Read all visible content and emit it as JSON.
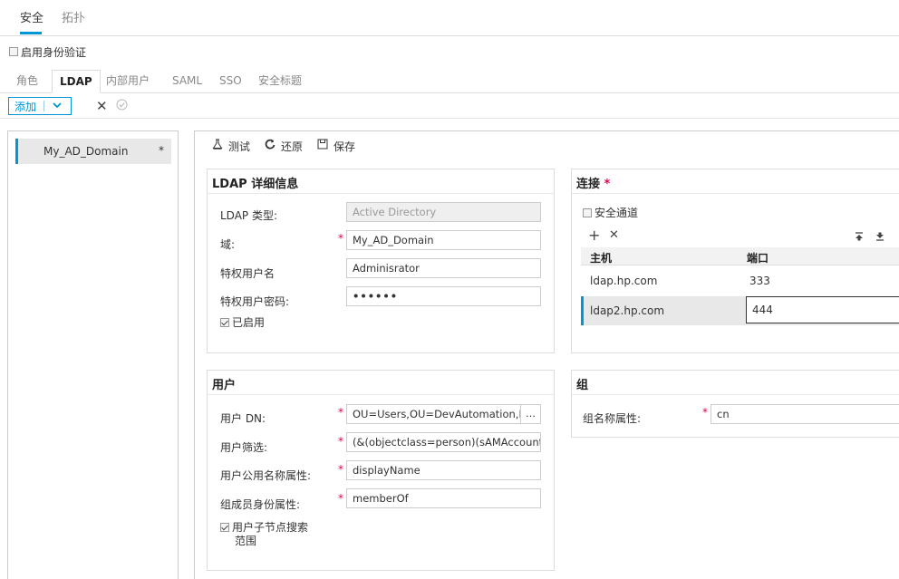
{
  "top_tabs": [
    "安全",
    "拓扑"
  ],
  "auth_checkbox_label": "启用身份验证",
  "sub_tabs": [
    "角色",
    "LDAP",
    "内部用户",
    "SAML",
    "SSO",
    "安全标题"
  ],
  "toolbar": {
    "add_label": "添加"
  },
  "left_list": {
    "item_label": "My_AD_Domain",
    "item_marker": "*"
  },
  "main_toolbar": {
    "test_label": "测试",
    "revert_label": "还原",
    "save_label": "保存"
  },
  "ldap_details": {
    "title": "LDAP 详细信息",
    "type_label": "LDAP 类型:",
    "type_value": "Active Directory",
    "domain_label": "域:",
    "domain_value": "My_AD_Domain",
    "priv_user_label": "特权用户名",
    "priv_user_value": "Adminisrator",
    "priv_pwd_label": "特权用户密码:",
    "priv_pwd_value": "••••••",
    "enabled_label": "已启用"
  },
  "connection": {
    "title": "连接",
    "required_mark": "*",
    "secure_channel_label": "安全通道",
    "col_host": "主机",
    "col_port": "端口",
    "rows": [
      {
        "host": "ldap.hp.com",
        "port": "333"
      },
      {
        "host": "ldap2.hp.com",
        "port": "444"
      }
    ]
  },
  "users": {
    "title": "用户",
    "dn_label": "用户 DN:",
    "dn_value": "OU=Users,OU=DevAutomation,DC=MyI",
    "filter_label": "用户筛选:",
    "filter_value": "(&(objectclass=person)(sAMAccountName",
    "cn_attr_label": "用户公用名称属性:",
    "cn_attr_value": "displayName",
    "member_attr_label": "组成员身份属性:",
    "member_attr_value": "memberOf",
    "subtree_label_line1": "用户子节点搜索",
    "subtree_label_line2": "范围"
  },
  "group": {
    "title": "组",
    "name_attr_label": "组名称属性:",
    "name_attr_value": "cn"
  },
  "required_star": "*",
  "colors": {
    "accent": "#0096d6",
    "required": "#e5004f"
  }
}
